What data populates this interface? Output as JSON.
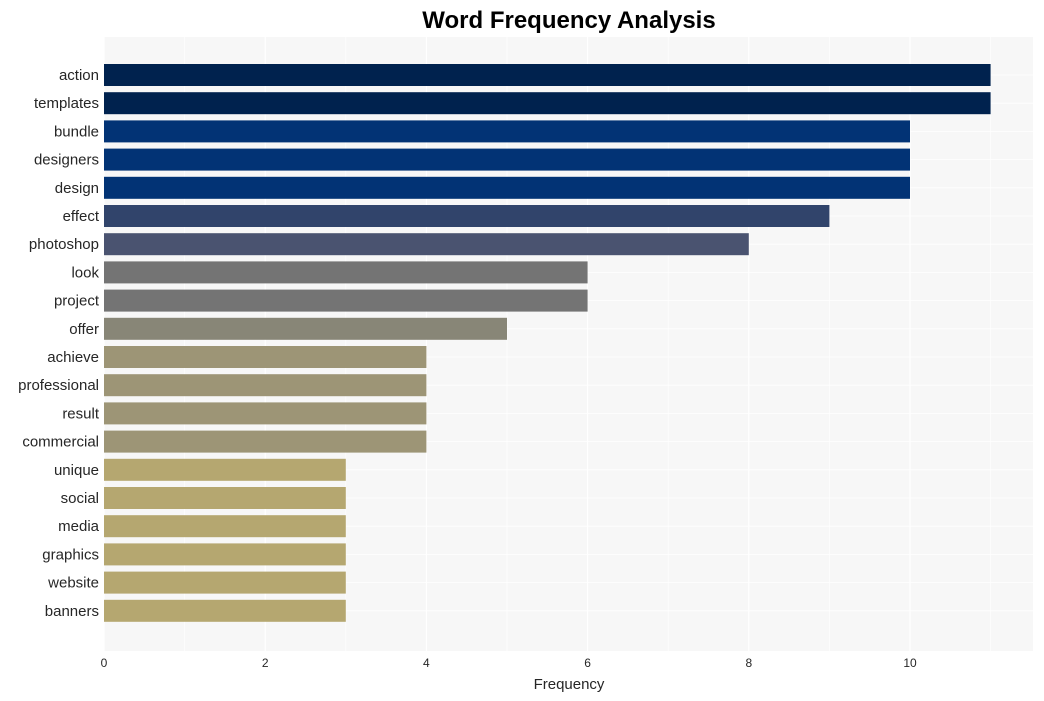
{
  "chart_data": {
    "type": "bar",
    "orientation": "horizontal",
    "title": "Word Frequency Analysis",
    "xlabel": "Frequency",
    "ylabel": "",
    "xlim": [
      0,
      11.5
    ],
    "xticks": [
      0,
      2,
      4,
      6,
      8,
      10
    ],
    "grid": true,
    "categories": [
      "action",
      "templates",
      "bundle",
      "designers",
      "design",
      "effect",
      "photoshop",
      "look",
      "project",
      "offer",
      "achieve",
      "professional",
      "result",
      "commercial",
      "unique",
      "social",
      "media",
      "graphics",
      "website",
      "banners"
    ],
    "values": [
      11,
      11,
      10,
      10,
      10,
      9,
      8,
      6,
      6,
      5,
      4,
      4,
      4,
      4,
      3,
      3,
      3,
      3,
      3,
      3
    ],
    "colors": [
      "#00224e",
      "#00224e",
      "#023375",
      "#023375",
      "#023375",
      "#31446b",
      "#4a5370",
      "#747474",
      "#747474",
      "#888677",
      "#9d9576",
      "#9d9576",
      "#9d9576",
      "#9d9576",
      "#b5a770",
      "#b5a770",
      "#b5a770",
      "#b5a770",
      "#b5a770",
      "#b5a770"
    ]
  },
  "colors": {
    "plot_background": "#f7f7f7",
    "grid": "#ffffff"
  }
}
